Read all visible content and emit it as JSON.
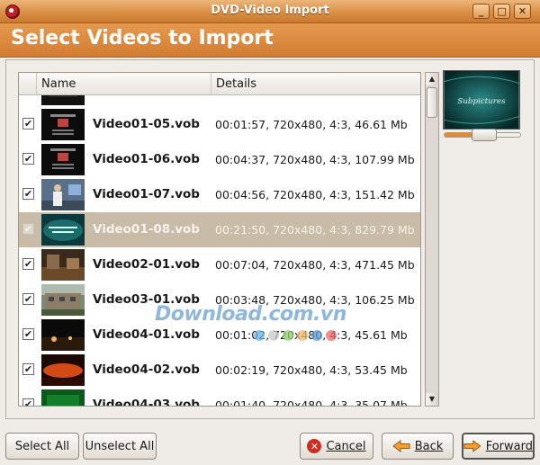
{
  "window": {
    "title": "DVD-Video Import",
    "minimize": "_",
    "maximize": "□",
    "close": "✕"
  },
  "header": {
    "title": "Select Videos to Import"
  },
  "table": {
    "columns": {
      "name": "Name",
      "details": "Details"
    },
    "rows": [
      {
        "name": "",
        "details": "",
        "checked": true,
        "selected": false,
        "thumb": "menu-thumbnail-dark"
      },
      {
        "name": "Video01-05.vob",
        "details": "00:01:57, 720x480, 4:3, 46.61 Mb",
        "checked": true,
        "selected": false,
        "thumb": "menu-thumbnail-dark"
      },
      {
        "name": "Video01-06.vob",
        "details": "00:04:37, 720x480, 4:3, 107.99 Mb",
        "checked": true,
        "selected": false,
        "thumb": "menu-thumbnail-dark"
      },
      {
        "name": "Video01-07.vob",
        "details": "00:04:56, 720x480, 4:3, 151.42 Mb",
        "checked": true,
        "selected": false,
        "thumb": "presenter-thumbnail"
      },
      {
        "name": "Video01-08.vob",
        "details": "00:21:50, 720x480, 4:3, 829.79 Mb",
        "checked": true,
        "selected": true,
        "thumb": "teal-title-thumbnail"
      },
      {
        "name": "Video02-01.vob",
        "details": "00:07:04, 720x480, 4:3, 471.45 Mb",
        "checked": true,
        "selected": false,
        "thumb": "brown-scene-thumbnail"
      },
      {
        "name": "Video03-01.vob",
        "details": "00:03:48, 720x480, 4:3, 106.25 Mb",
        "checked": true,
        "selected": false,
        "thumb": "building-thumbnail"
      },
      {
        "name": "Video04-01.vob",
        "details": "00:01:02, 720x480, 4:3, 45.61 Mb",
        "checked": true,
        "selected": false,
        "thumb": "night-scene-thumbnail"
      },
      {
        "name": "Video04-02.vob",
        "details": "00:02:19, 720x480, 4:3, 53.45 Mb",
        "checked": true,
        "selected": false,
        "thumb": "orange-landscape-thumbnail"
      },
      {
        "name": "Video04-03.vob",
        "details": "00:01:40, 720x480, 4:3, 35.07 Mb",
        "checked": true,
        "selected": false,
        "thumb": "green-thumbnail"
      }
    ]
  },
  "preview": {
    "caption": "Subpictures",
    "slider_level": 0.5
  },
  "buttons": {
    "select_all": "Select All",
    "unselect_all": "Unselect All",
    "cancel": "Cancel",
    "back": "Back",
    "forward": "Forward"
  },
  "watermark": {
    "text": "Download.com.vn"
  },
  "colors": {
    "accent": "#d98f45",
    "selection": "#c8bba8"
  }
}
